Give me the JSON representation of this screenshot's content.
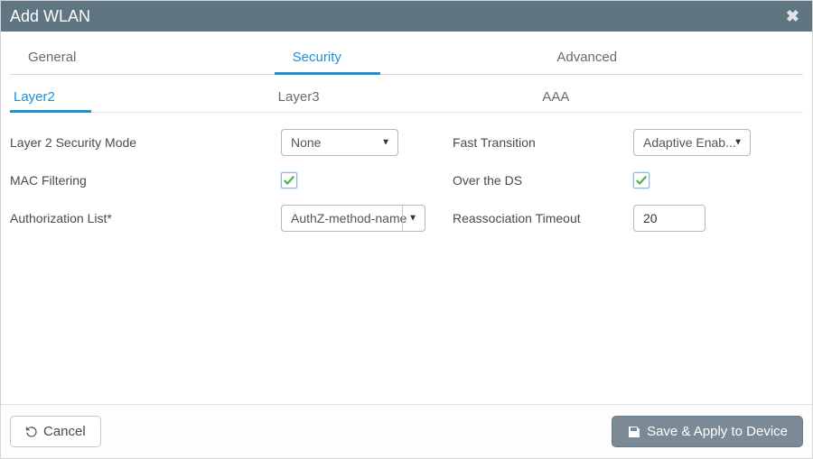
{
  "header": {
    "title": "Add WLAN"
  },
  "tabs": {
    "items": [
      {
        "label": "General"
      },
      {
        "label": "Security"
      },
      {
        "label": "Advanced"
      }
    ],
    "activeIndex": 1
  },
  "subtabs": {
    "items": [
      {
        "label": "Layer2"
      },
      {
        "label": "Layer3"
      },
      {
        "label": "AAA"
      }
    ],
    "activeIndex": 0
  },
  "form": {
    "left": {
      "securityModeLabel": "Layer 2 Security Mode",
      "securityModeValue": "None",
      "macFilteringLabel": "MAC Filtering",
      "macFilteringChecked": true,
      "authListLabel": "Authorization List*",
      "authListValue": "AuthZ-method-name"
    },
    "right": {
      "fastTransitionLabel": "Fast Transition",
      "fastTransitionValue": "Adaptive Enab...",
      "overDsLabel": "Over the DS",
      "overDsChecked": true,
      "reassocLabel": "Reassociation Timeout",
      "reassocValue": "20"
    }
  },
  "footer": {
    "cancelLabel": "Cancel",
    "applyLabel": "Save & Apply to Device"
  }
}
